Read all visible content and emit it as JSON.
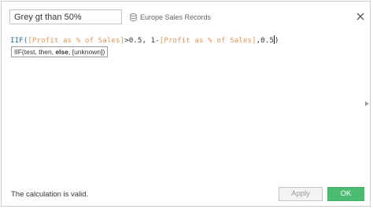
{
  "header": {
    "calc_name": "Grey gt than 50%",
    "datasource_label": "Europe Sales Records"
  },
  "formula": {
    "fn_open": "IIF(",
    "field1": "[Profit as % of Sales]",
    "mid": ">0.5, 1-",
    "field2": "[Profit as % of Sales]",
    "tail_before_cursor": ",0.5",
    "tail_after_cursor": ")"
  },
  "tooltip": {
    "pre": "IIF(test, then, ",
    "bold": "else",
    "post": ", [unknown])"
  },
  "footer": {
    "status": "The calculation is valid.",
    "apply_label": "Apply",
    "ok_label": "OK"
  },
  "colors": {
    "ok_green": "#4cbb71",
    "keyword_blue": "#2b6ca3",
    "field_orange": "#e8955a"
  },
  "icons": {
    "datasource": "datasource-icon",
    "close": "close-icon",
    "expand": "expand-arrow-icon"
  }
}
